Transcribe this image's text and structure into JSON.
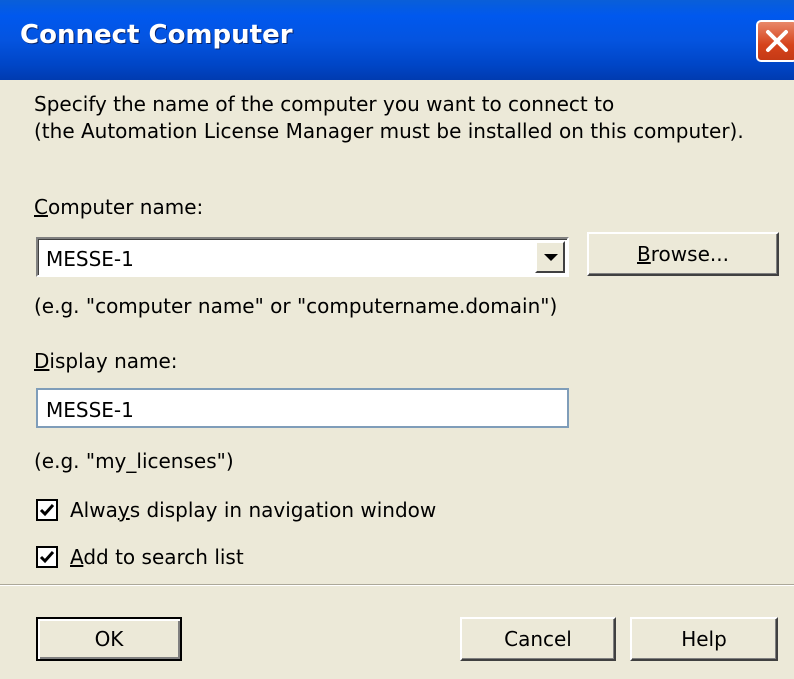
{
  "window": {
    "title": "Connect Computer"
  },
  "intro": {
    "line1": "Specify the name of the computer you want to connect to",
    "line2": "(the Automation License Manager must be installed on this computer)."
  },
  "computer_name": {
    "label_first": "C",
    "label_rest": "omputer name:",
    "value": "MESSE-1",
    "hint": "(e.g. \"computer name\" or \"computername.domain\")",
    "browse_first": "B",
    "browse_rest": "rowse..."
  },
  "display_name": {
    "label_first": "D",
    "label_rest": "isplay name:",
    "value": "MESSE-1",
    "hint": "(e.g. \"my_licenses\")"
  },
  "options": {
    "always_display_pre": "Alwa",
    "always_display_key": "y",
    "always_display_post": "s display in navigation window",
    "always_display_checked": true,
    "add_search_key": "A",
    "add_search_rest": "dd to search list",
    "add_search_checked": true
  },
  "buttons": {
    "ok": "OK",
    "cancel": "Cancel",
    "help": "Help"
  },
  "icons": {
    "close": "close-icon",
    "dropdown": "chevron-down-icon",
    "check": "checkmark-icon"
  }
}
